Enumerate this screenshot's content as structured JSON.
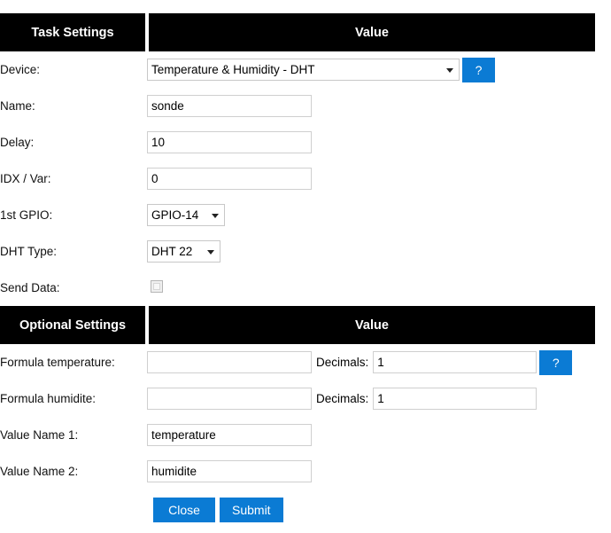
{
  "colors": {
    "header_bg": "#000000",
    "header_fg": "#ffffff",
    "accent_blue": "#0b7bd4",
    "page_bg": "#ffffff",
    "input_border": "#cfcfcf"
  },
  "sections": [
    {
      "header": {
        "label_col": "Task Settings",
        "value_col": "Value"
      },
      "rows": [
        {
          "label": "Device:",
          "control": "select",
          "value": "Temperature & Humidity - DHT",
          "help": "?"
        },
        {
          "label": "Name:",
          "control": "text",
          "value": "sonde",
          "placeholder": ""
        },
        {
          "label": "Delay:",
          "control": "text",
          "value": "10",
          "placeholder": ""
        },
        {
          "label": "IDX / Var:",
          "control": "text",
          "value": "0",
          "placeholder": ""
        },
        {
          "label": "1st GPIO:",
          "control": "select",
          "value": "GPIO-14"
        },
        {
          "label": "DHT Type:",
          "control": "select",
          "value": "DHT 22"
        },
        {
          "label": "Send Data:",
          "control": "checkbox",
          "checked": false
        }
      ]
    },
    {
      "header": {
        "label_col": "Optional Settings",
        "value_col": "Value"
      },
      "rows": [
        {
          "label": "Formula temperature:",
          "control": "text-with-decimals",
          "value": "",
          "placeholder": "",
          "decimals_label": "Decimals:",
          "decimals_value": "1",
          "help": "?"
        },
        {
          "label": "Formula humidite:",
          "control": "text-with-decimals",
          "value": "",
          "placeholder": "",
          "decimals_label": "Decimals:",
          "decimals_value": "1"
        },
        {
          "label": "Value Name 1:",
          "control": "text",
          "value": "temperature",
          "placeholder": ""
        },
        {
          "label": "Value Name 2:",
          "control": "text",
          "value": "humidite",
          "placeholder": ""
        }
      ]
    }
  ],
  "footer": {
    "close_label": "Close",
    "submit_label": "Submit"
  }
}
